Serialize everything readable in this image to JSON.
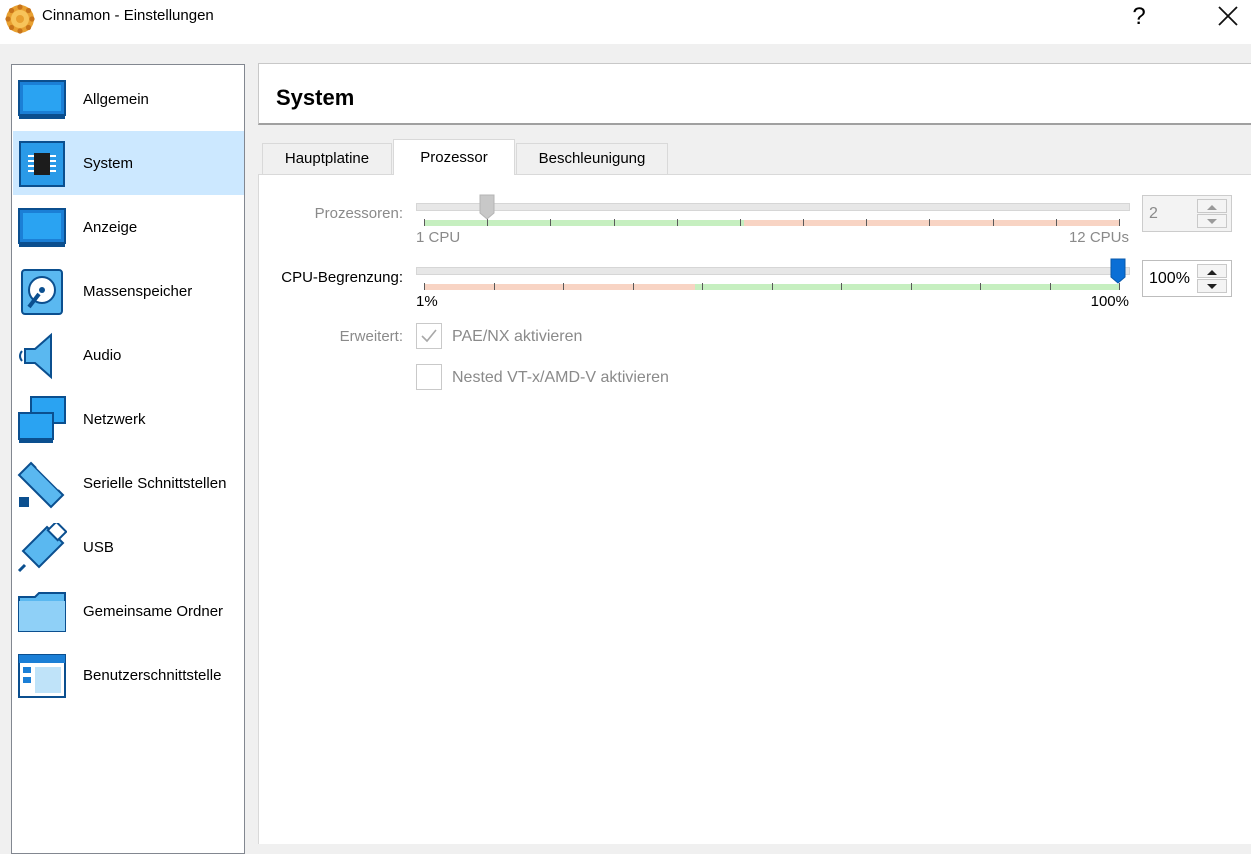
{
  "window": {
    "title": "Cinnamon - Einstellungen",
    "help_glyph": "?"
  },
  "sidebar": {
    "items": [
      {
        "label": "Allgemein",
        "icon": "general-icon"
      },
      {
        "label": "System",
        "icon": "system-chip-icon",
        "selected": true
      },
      {
        "label": "Anzeige",
        "icon": "display-icon"
      },
      {
        "label": "Massenspeicher",
        "icon": "storage-icon"
      },
      {
        "label": "Audio",
        "icon": "audio-speaker-icon"
      },
      {
        "label": "Netzwerk",
        "icon": "network-icon"
      },
      {
        "label": "Serielle Schnittstellen",
        "icon": "serial-port-icon"
      },
      {
        "label": "USB",
        "icon": "usb-icon"
      },
      {
        "label": "Gemeinsame Ordner",
        "icon": "shared-folder-icon"
      },
      {
        "label": "Benutzerschnittstelle",
        "icon": "user-interface-icon"
      }
    ]
  },
  "page": {
    "title": "System"
  },
  "tabs": [
    {
      "label": "Hauptplatine",
      "active": false
    },
    {
      "label": "Prozessor",
      "active": true
    },
    {
      "label": "Beschleunigung",
      "active": false
    }
  ],
  "processors": {
    "label": "Prozessoren:",
    "min_label": "1 CPU",
    "max_label": "12 CPUs",
    "value": "2",
    "min": 1,
    "max": 12,
    "enabled": false
  },
  "cpu_limit": {
    "label": "CPU-Begrenzung:",
    "min_label": "1%",
    "max_label": "100%",
    "value": "100%",
    "level": 100,
    "enabled": true
  },
  "extended": {
    "label": "Erweitert:",
    "pae_label": "PAE/NX aktivieren",
    "pae_checked": true,
    "nested_label": "Nested VT-x/AMD-V aktivieren",
    "nested_checked": false
  },
  "colors": {
    "selection": "#cce8ff",
    "scale_green": "#c6efc0",
    "scale_red": "#f8d4c4",
    "slider_accent": "#0a6fd6",
    "slider_disabled": "#c8c8c8"
  }
}
